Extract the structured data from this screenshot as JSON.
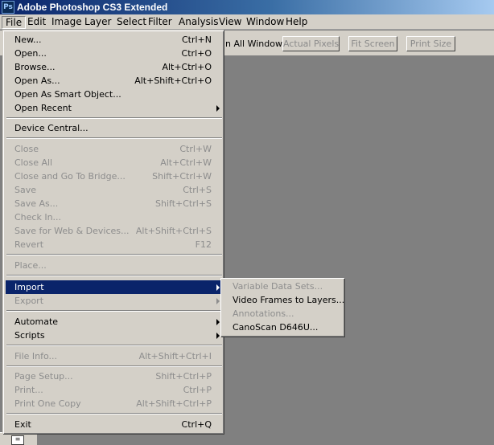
{
  "window": {
    "title": "Adobe Photoshop CS3 Extended",
    "app_icon_text": "Ps"
  },
  "menubar": [
    "File",
    "Edit",
    "Image",
    "Layer",
    "Select",
    "Filter",
    "Analysis",
    "View",
    "Window",
    "Help"
  ],
  "toolbar": {
    "label_partial": "n All Windows",
    "buttons": [
      "Actual Pixels",
      "Fit Screen",
      "Print Size"
    ]
  },
  "file_menu": {
    "items": [
      {
        "label": "New...",
        "shortcut": "Ctrl+N"
      },
      {
        "label": "Open...",
        "shortcut": "Ctrl+O"
      },
      {
        "label": "Browse...",
        "shortcut": "Alt+Ctrl+O"
      },
      {
        "label": "Open As...",
        "shortcut": "Alt+Shift+Ctrl+O"
      },
      {
        "label": "Open As Smart Object...",
        "shortcut": ""
      },
      {
        "label": "Open Recent",
        "shortcut": ""
      },
      {
        "label": "Device Central...",
        "shortcut": ""
      },
      {
        "label": "Close",
        "shortcut": "Ctrl+W"
      },
      {
        "label": "Close All",
        "shortcut": "Alt+Ctrl+W"
      },
      {
        "label": "Close and Go To Bridge...",
        "shortcut": "Shift+Ctrl+W"
      },
      {
        "label": "Save",
        "shortcut": "Ctrl+S"
      },
      {
        "label": "Save As...",
        "shortcut": "Shift+Ctrl+S"
      },
      {
        "label": "Check In...",
        "shortcut": ""
      },
      {
        "label": "Save for Web & Devices...",
        "shortcut": "Alt+Shift+Ctrl+S"
      },
      {
        "label": "Revert",
        "shortcut": "F12"
      },
      {
        "label": "Place...",
        "shortcut": ""
      },
      {
        "label": "Import",
        "shortcut": ""
      },
      {
        "label": "Export",
        "shortcut": ""
      },
      {
        "label": "Automate",
        "shortcut": ""
      },
      {
        "label": "Scripts",
        "shortcut": ""
      },
      {
        "label": "File Info...",
        "shortcut": "Alt+Shift+Ctrl+I"
      },
      {
        "label": "Page Setup...",
        "shortcut": "Shift+Ctrl+P"
      },
      {
        "label": "Print...",
        "shortcut": "Ctrl+P"
      },
      {
        "label": "Print One Copy",
        "shortcut": "Alt+Shift+Ctrl+P"
      },
      {
        "label": "Exit",
        "shortcut": "Ctrl+Q"
      }
    ]
  },
  "import_submenu": {
    "items": [
      {
        "label": "Variable Data Sets..."
      },
      {
        "label": "Video Frames to Layers..."
      },
      {
        "label": "Annotations..."
      },
      {
        "label": "CanoScan D646U..."
      }
    ]
  },
  "colors": {
    "highlight": "#0a246a",
    "workspace": "#808080",
    "menu_bg": "#d4d0c8",
    "disabled_text": "#8d8d8d"
  }
}
